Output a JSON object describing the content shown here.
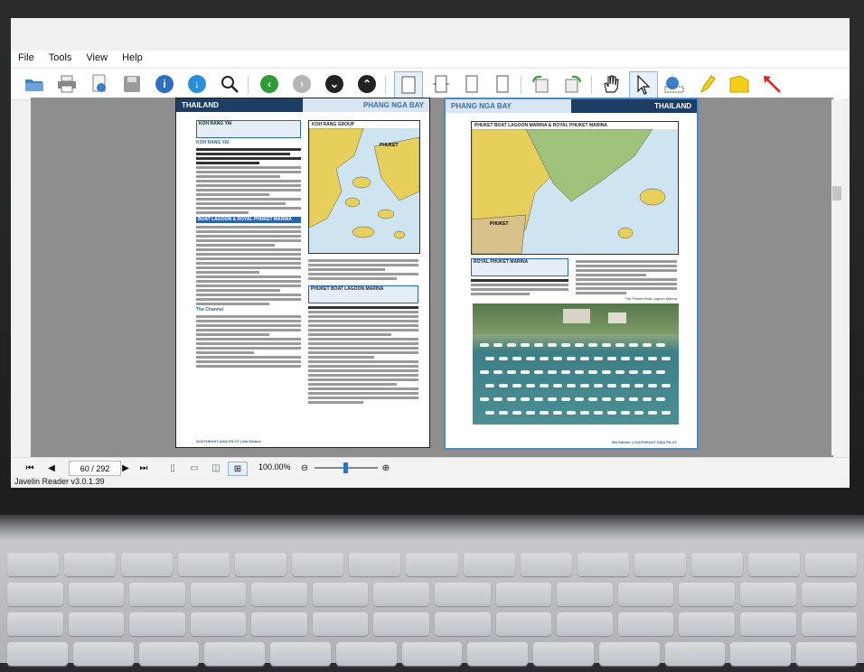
{
  "menu": [
    "File",
    "Tools",
    "View",
    "Help"
  ],
  "left_page": {
    "header_left": "THAILAND",
    "header_right": "PHANG NGA BAY",
    "box1_title": "KOH RANG YAI",
    "section1": "KOH RANG YAI",
    "section2": "BOAT LAGOON & ROYAL PHUKET MARINA",
    "subhead": "The Channel",
    "map_title": "KOH RANG GROUP",
    "map_label": "PHUKET",
    "box2_title": "PHUKET BOAT LAGOON MARINA",
    "footer": "SOUTHEAST ASIA PILOT | 8th Edition"
  },
  "right_page": {
    "header_left": "PHANG NGA BAY",
    "header_right": "THAILAND",
    "map_title": "PHUKET BOAT LAGOON MARINA & ROYAL PHUKET MARINA",
    "map_label": "PHUKET",
    "box_title": "ROYAL PHUKET MARINA",
    "photo_caption": "The Phuket Boat Lagoon Marina",
    "footer": "8th Edition | SOUTHEAST ASIA PILOT"
  },
  "nav": {
    "page": "60 / 292",
    "zoom": "100.00%"
  },
  "status": "Javelin Reader v3.0.1.39",
  "colors": {
    "accent": "#1c3d66",
    "link": "#2b64a8",
    "green_btn": "#2e9a3a"
  }
}
